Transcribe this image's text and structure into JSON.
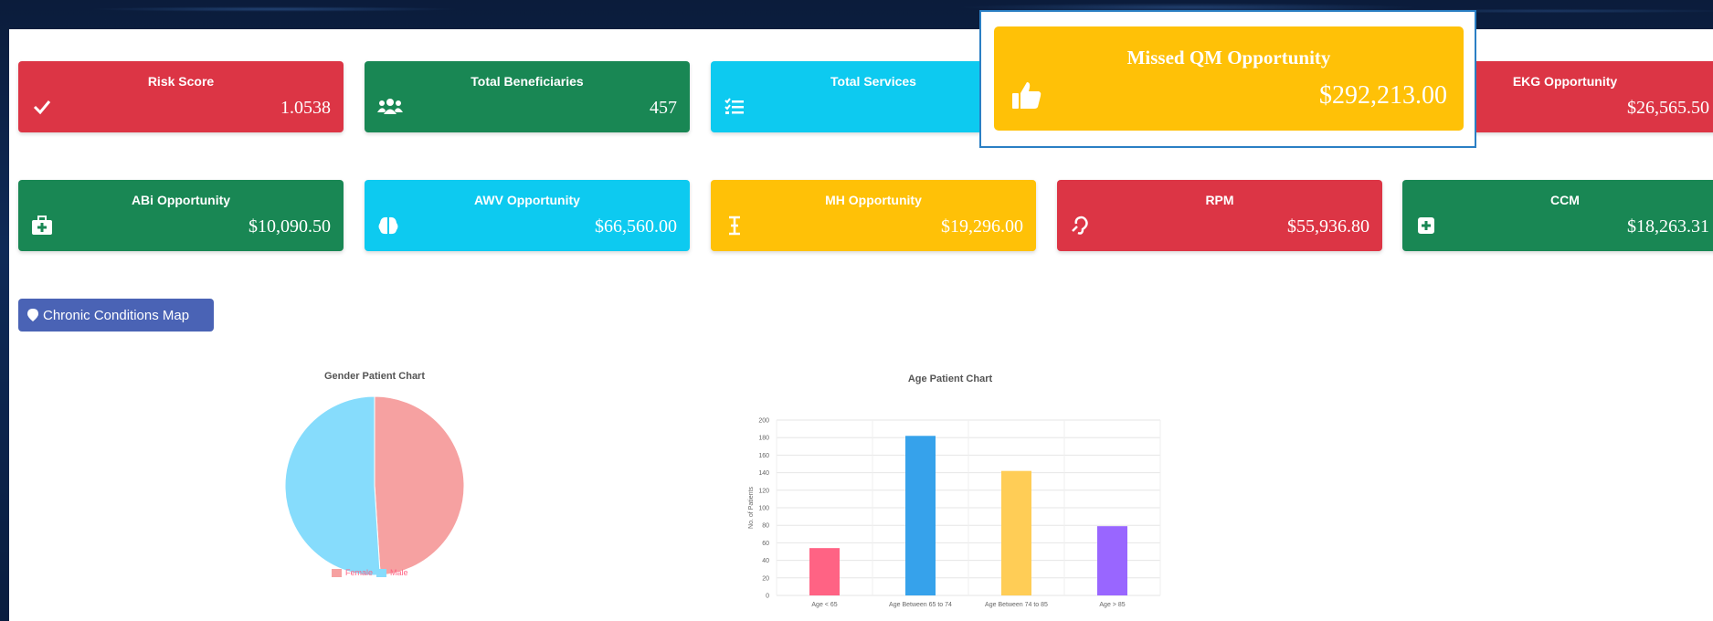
{
  "cards_row1": [
    {
      "title": "Risk Score",
      "value": "1.0538",
      "color": "#dc3545",
      "icon": "check-icon"
    },
    {
      "title": "Total Beneficiaries",
      "value": "457",
      "color": "#198754",
      "icon": "users-icon"
    },
    {
      "title": "Total Services",
      "value": "",
      "color": "#0dcaf0",
      "icon": "list-check-icon"
    },
    {
      "title": "EKG Opportunity",
      "value": "$26,565.50",
      "color": "#dc3545",
      "icon": ""
    }
  ],
  "highlight_card": {
    "title": "Missed QM Opportunity",
    "value": "$292,213.00",
    "color": "#ffc107",
    "icon": "thumbs-up-icon"
  },
  "cards_row2": [
    {
      "title": "ABi Opportunity",
      "value": "$10,090.50",
      "color": "#198754",
      "icon": "medical-kit-icon"
    },
    {
      "title": "AWV Opportunity",
      "value": "$66,560.00",
      "color": "#0dcaf0",
      "icon": "brain-icon"
    },
    {
      "title": "MH Opportunity",
      "value": "$19,296.00",
      "color": "#ffc107",
      "icon": "i-cursor-icon"
    },
    {
      "title": "RPM",
      "value": "$55,936.80",
      "color": "#dc3545",
      "icon": "ear-icon"
    },
    {
      "title": "CCM",
      "value": "$18,263.31",
      "color": "#198754",
      "icon": "plus-square-icon"
    }
  ],
  "map_button": {
    "label": "Chronic Conditions Map",
    "icon": "map-pin-icon"
  },
  "charts": [
    {
      "chart_data": {
        "type": "pie",
        "title": "Gender Patient Chart",
        "categories": [
          "Female",
          "Male"
        ],
        "values": [
          49,
          51
        ],
        "colors": [
          "#f6a1a1",
          "#86dcfc"
        ],
        "legend_position": "bottom"
      }
    },
    {
      "chart_data": {
        "type": "bar",
        "title": "Age Patient Chart",
        "ylabel": "No. of Patients",
        "xlabel": "",
        "categories": [
          "Age < 65",
          "Age Between 65 to 74",
          "Age Between 74 to 85",
          "Age > 85"
        ],
        "values": [
          54,
          182,
          142,
          79
        ],
        "colors": [
          "#ff6384",
          "#36a2eb",
          "#ffcd56",
          "#9966ff"
        ],
        "ylim": [
          0,
          200
        ],
        "yticks": [
          0,
          20,
          40,
          60,
          80,
          100,
          120,
          140,
          160,
          180,
          200
        ],
        "grid": true
      }
    }
  ]
}
